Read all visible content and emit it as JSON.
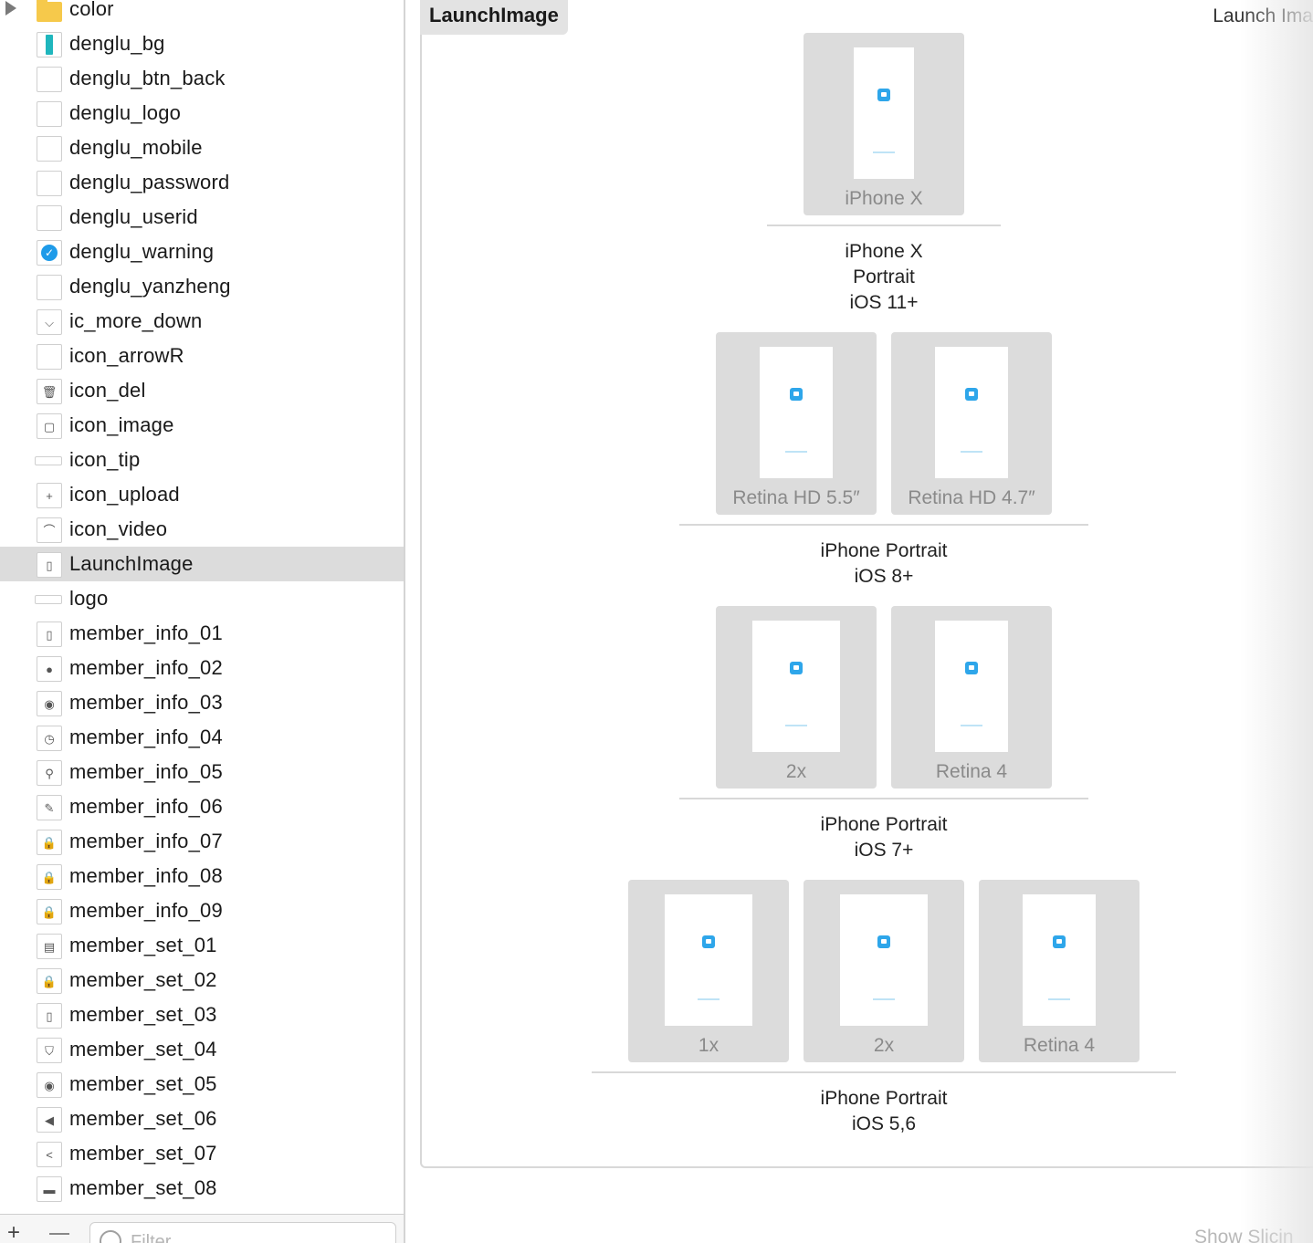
{
  "sidebar": {
    "items": [
      {
        "label": "color",
        "icon": "folder-icon"
      },
      {
        "label": "denglu_bg",
        "icon": "image-thumbnail-teal-icon"
      },
      {
        "label": "denglu_btn_back",
        "icon": "blank-image-icon"
      },
      {
        "label": "denglu_logo",
        "icon": "blank-image-icon"
      },
      {
        "label": "denglu_mobile",
        "icon": "blank-image-icon"
      },
      {
        "label": "denglu_password",
        "icon": "blank-image-icon"
      },
      {
        "label": "denglu_userid",
        "icon": "blank-image-icon"
      },
      {
        "label": "denglu_warning",
        "icon": "check-circle-icon"
      },
      {
        "label": "denglu_yanzheng",
        "icon": "blank-image-icon"
      },
      {
        "label": "ic_more_down",
        "icon": "chevron-down-icon"
      },
      {
        "label": "icon_arrowR",
        "icon": "blank-image-icon"
      },
      {
        "label": "icon_del",
        "icon": "trash-icon"
      },
      {
        "label": "icon_image",
        "icon": "image-icon"
      },
      {
        "label": "icon_tip",
        "icon": "bar-icon"
      },
      {
        "label": "icon_upload",
        "icon": "plus-icon"
      },
      {
        "label": "icon_video",
        "icon": "video-icon"
      },
      {
        "label": "LaunchImage",
        "icon": "launch-image-icon"
      },
      {
        "label": "logo",
        "icon": "logo-image-icon"
      },
      {
        "label": "member_info_01",
        "icon": "phone-icon"
      },
      {
        "label": "member_info_02",
        "icon": "person-icon"
      },
      {
        "label": "member_info_03",
        "icon": "badge-icon"
      },
      {
        "label": "member_info_04",
        "icon": "clock-icon"
      },
      {
        "label": "member_info_05",
        "icon": "location-pin-icon"
      },
      {
        "label": "member_info_06",
        "icon": "edit-icon"
      },
      {
        "label": "member_info_07",
        "icon": "lock-icon"
      },
      {
        "label": "member_info_08",
        "icon": "lock-icon"
      },
      {
        "label": "member_info_09",
        "icon": "lock-icon"
      },
      {
        "label": "member_set_01",
        "icon": "id-card-icon"
      },
      {
        "label": "member_set_02",
        "icon": "lock-icon"
      },
      {
        "label": "member_set_03",
        "icon": "phone-icon"
      },
      {
        "label": "member_set_04",
        "icon": "shield-icon"
      },
      {
        "label": "member_set_05",
        "icon": "circle-icon"
      },
      {
        "label": "member_set_06",
        "icon": "speaker-icon"
      },
      {
        "label": "member_set_07",
        "icon": "share-icon"
      },
      {
        "label": "member_set_08",
        "icon": "message-icon"
      }
    ],
    "selected_index": 16,
    "bottom": {
      "add": "+",
      "filter_placeholder": "Filter"
    }
  },
  "main": {
    "set_name": "LaunchImage",
    "set_type": "Launch Ima",
    "groups": [
      {
        "caption_lines": [
          "iPhone X",
          "Portrait",
          "iOS 11+"
        ],
        "slots": [
          "iPhone X"
        ]
      },
      {
        "caption_lines": [
          "iPhone Portrait",
          "iOS 8+"
        ],
        "slots": [
          "Retina HD 5.5″",
          "Retina HD 4.7″"
        ]
      },
      {
        "caption_lines": [
          "iPhone Portrait",
          "iOS 7+"
        ],
        "slots": [
          "2x",
          "Retina 4"
        ]
      },
      {
        "caption_lines": [
          "iPhone Portrait",
          "iOS 5,6"
        ],
        "slots": [
          "1x",
          "2x",
          "Retina 4"
        ]
      }
    ],
    "footer_right": "Show Slicin"
  }
}
